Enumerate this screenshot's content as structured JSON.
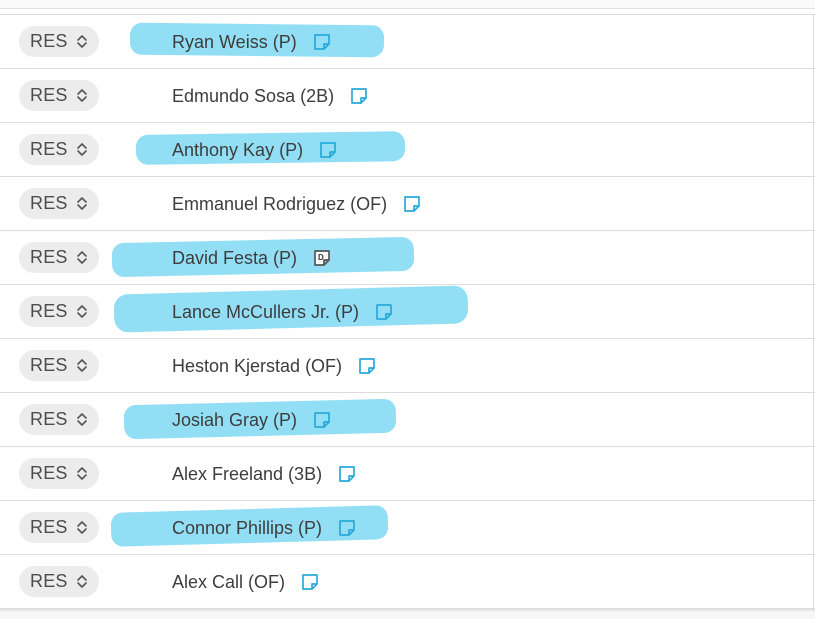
{
  "roster": {
    "rows": [
      {
        "slot": "RES",
        "player": "Ryan Weiss (P)",
        "note": "note-icon"
      },
      {
        "slot": "RES",
        "player": "Edmundo Sosa (2B)",
        "note": "note-icon"
      },
      {
        "slot": "RES",
        "player": "Anthony Kay (P)",
        "note": "note-icon"
      },
      {
        "slot": "RES",
        "player": "Emmanuel Rodriguez (OF)",
        "note": "note-icon"
      },
      {
        "slot": "RES",
        "player": "David Festa (P)",
        "note": "note-with-d-icon",
        "note_badge": "D"
      },
      {
        "slot": "RES",
        "player": "Lance McCullers Jr. (P)",
        "note": "note-icon"
      },
      {
        "slot": "RES",
        "player": "Heston Kjerstad (OF)",
        "note": "note-icon"
      },
      {
        "slot": "RES",
        "player": "Josiah Gray (P)",
        "note": "note-icon"
      },
      {
        "slot": "RES",
        "player": "Alex Freeland (3B)",
        "note": "note-icon"
      },
      {
        "slot": "RES",
        "player": "Connor Phillips (P)",
        "note": "note-icon"
      },
      {
        "slot": "RES",
        "player": "Alex Call (OF)",
        "note": "note-icon"
      }
    ]
  },
  "colors": {
    "highlight": "#7fd8f3",
    "note_icon": "#29a9d8",
    "slot_bg": "#ececec",
    "text": "#3d3d3d"
  }
}
